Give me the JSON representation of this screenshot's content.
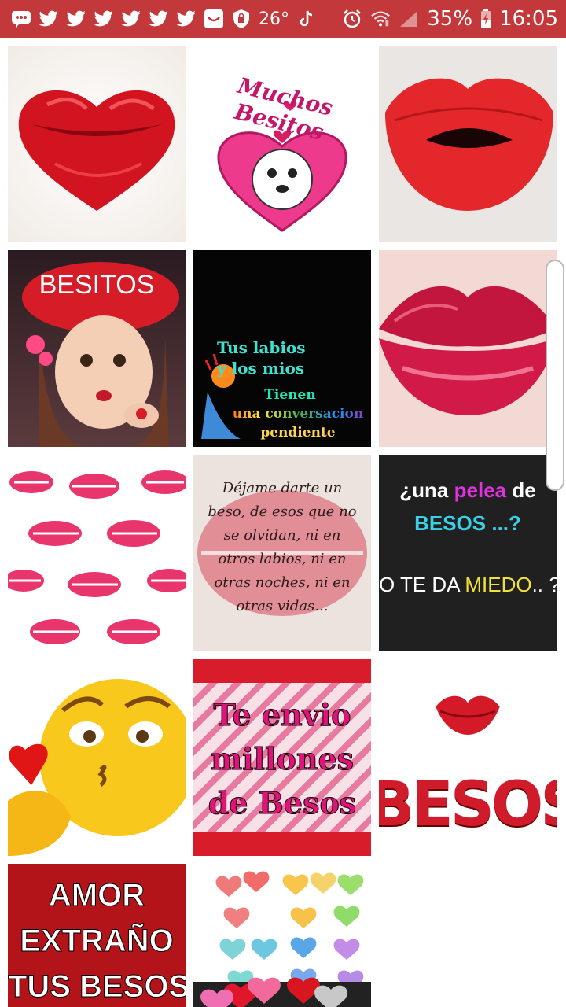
{
  "status_bar": {
    "temperature": "26°",
    "battery": "35%",
    "time": "16:05",
    "left_icons": [
      "message-icon",
      "twitter-icon",
      "twitter-icon",
      "twitter-icon",
      "twitter-icon",
      "twitter-icon",
      "twitter-icon",
      "inbox-icon",
      "lock-shield-icon"
    ],
    "right_icons": [
      "tiktok-icon",
      "alarm-icon",
      "wifi-icon",
      "signal-icon",
      "battery-icon"
    ],
    "bg_color": "#c3393b"
  },
  "gallery": {
    "tiles": [
      {
        "id": "lips-heart"
      },
      {
        "id": "muchos-besitos",
        "text": "Muchos Besitos"
      },
      {
        "id": "felt-lips"
      },
      {
        "id": "besitos-girl",
        "text": "BESITOS"
      },
      {
        "id": "tus-labios",
        "line1": "Tus labios",
        "line2": "y los mios",
        "line3": "Tienen",
        "line4": "una conversacion",
        "line5": "pendiente"
      },
      {
        "id": "glossy-lips"
      },
      {
        "id": "kiss-pattern"
      },
      {
        "id": "dejame-darte",
        "text": "Déjame darte un beso, de esos que no se olvidan, ni en otros labios, ni en otras noches, ni en otras vidas..."
      },
      {
        "id": "pelea-besos",
        "line1a": "¿una ",
        "line1b": "pelea",
        "line1c": " de",
        "line2": "BESOS ...?",
        "line3a": "O TE DA ",
        "line3b": "MIEDO",
        "line3c": ".. ??"
      },
      {
        "id": "emoji-kiss"
      },
      {
        "id": "te-envio",
        "line1": "Te envio",
        "line2": "millones",
        "line3": "de Besos"
      },
      {
        "id": "besos-glitter",
        "text": "BESOS"
      },
      {
        "id": "amor-extrano",
        "line1": "AMOR",
        "line2": "EXTRAÑO",
        "line3": "TUS BESOS"
      },
      {
        "id": "hearts"
      }
    ]
  }
}
